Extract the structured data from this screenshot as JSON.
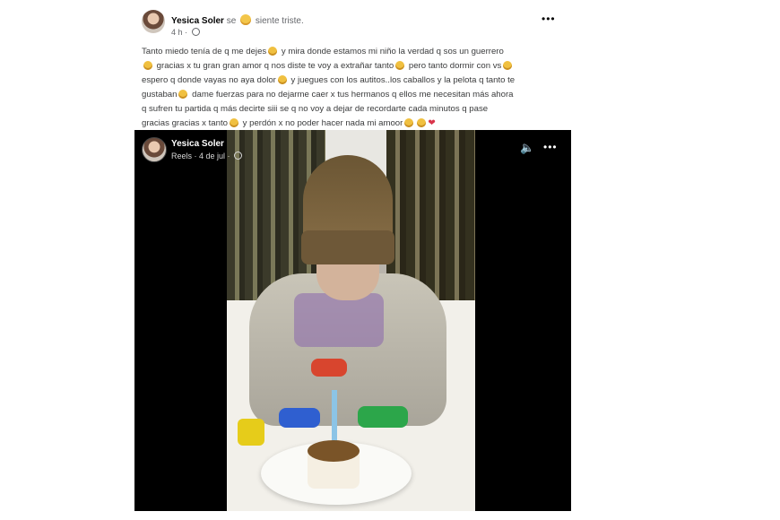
{
  "post": {
    "author": "Yesica Soler",
    "feeling_prefix": "se",
    "feeling": "siente triste.",
    "time": "4 h ·",
    "more": "•••",
    "text_lines": [
      "Tanto miedo tenía de q me dejes",
      "y mira donde estamos mi niño la verdad q sos un guerrero",
      "gracias x tu gran gran amor q nos diste te voy a extrañar tanto",
      "pero tanto dormir con vs",
      "espero q donde vayas no aya dolor",
      "y juegues con los autitos..los caballos y la pelota q tanto te",
      "gustaban",
      "dame fuerzas para no dejarme caer x tus hermanos q ellos me necesitan más ahora",
      "q sufren tu partida q más decirte siii se q no voy a dejar de recordarte cada minutos q pase",
      "gracias gracias x tanto",
      "y perdón x no poder hacer nada mi amoor"
    ]
  },
  "video": {
    "author": "Yesica Soler",
    "meta": "Reels · 4 de jul ·",
    "sound_icon": "speaker-icon",
    "more": "•••"
  }
}
